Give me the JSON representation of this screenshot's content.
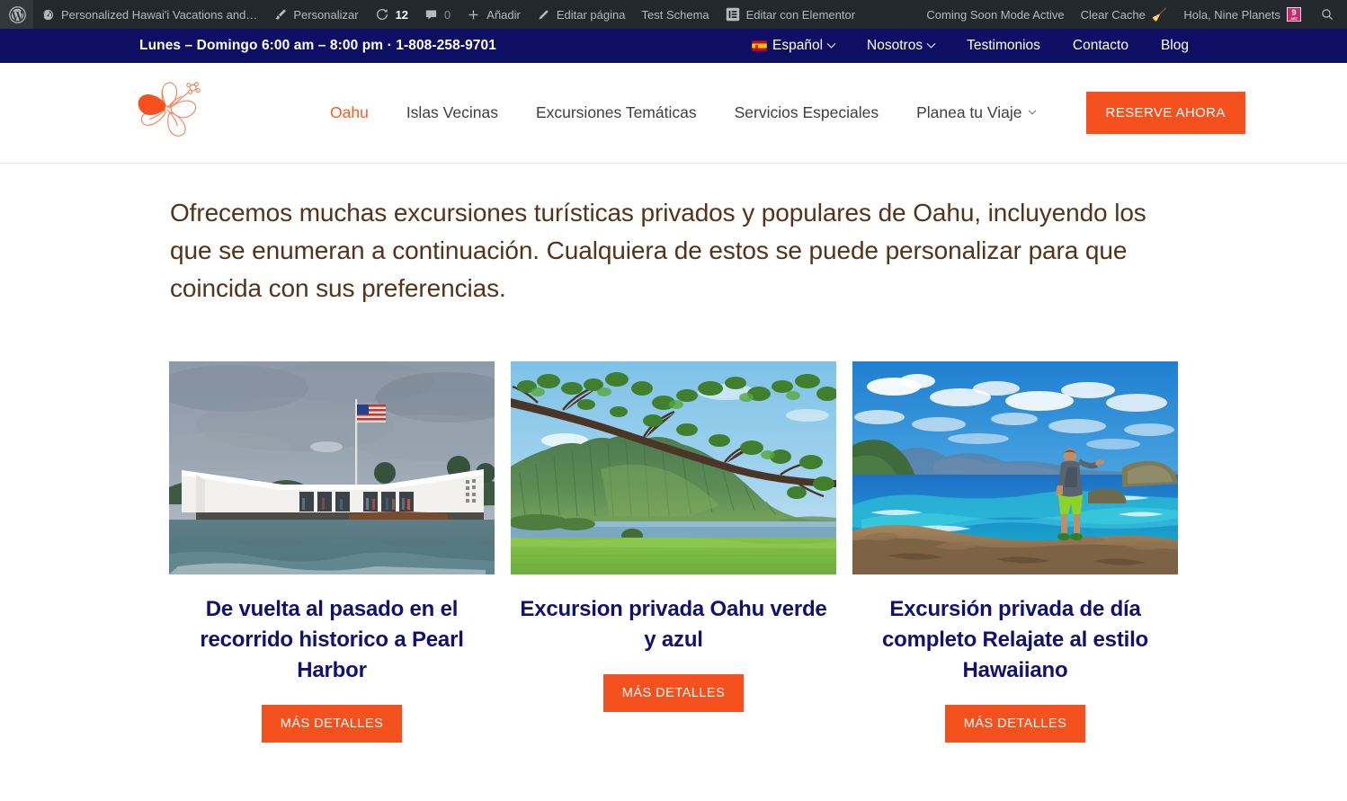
{
  "admin_bar": {
    "logo_icon": "wordpress-icon",
    "items": [
      {
        "label": "Personalized Hawai'i Vacations and…",
        "icon": "dashboard-icon",
        "name": "site-name"
      },
      {
        "label": "Personalizar",
        "icon": "paintbrush-icon",
        "name": "customize"
      },
      {
        "label": "12",
        "icon": "updates-icon",
        "name": "updates"
      },
      {
        "label": "0",
        "icon": "comment-icon",
        "name": "comments"
      },
      {
        "label": "Añadir",
        "icon": "plus-icon",
        "name": "new-content"
      },
      {
        "label": "Editar página",
        "icon": "pencil-icon",
        "name": "edit-page"
      },
      {
        "label": "Test Schema",
        "icon": "",
        "name": "test-schema"
      },
      {
        "label": "Editar con Elementor",
        "icon": "elementor-icon",
        "name": "edit-with-elementor"
      }
    ],
    "right_items": [
      {
        "label": "Coming Soon Mode Active",
        "icon": "",
        "name": "coming-soon-mode"
      },
      {
        "label": "Clear Cache",
        "icon": "broom-icon",
        "name": "clear-cache"
      },
      {
        "label": "Hola, Nine Planets",
        "icon": "avatar",
        "name": "my-account"
      }
    ],
    "search_icon": "search-icon",
    "avatar_text": "9"
  },
  "top_bar": {
    "contact": "Lunes – Domingo 6:00 am – 8:00 pm · 1-808-258-9701",
    "menu": [
      {
        "label": "Español",
        "icon": "spanish-flag-icon",
        "caret": true,
        "name": "language-selector"
      },
      {
        "label": "Nosotros",
        "icon": "",
        "caret": true,
        "name": "top-nav-nosotros"
      },
      {
        "label": "Testimonios",
        "icon": "",
        "caret": false,
        "name": "top-nav-testimonios"
      },
      {
        "label": "Contacto",
        "icon": "",
        "caret": false,
        "name": "top-nav-contacto"
      },
      {
        "label": "Blog",
        "icon": "",
        "caret": false,
        "name": "top-nav-blog"
      }
    ]
  },
  "header": {
    "logo_icon": "hibiscus-flower-logo",
    "nav": [
      {
        "label": "Oahu",
        "caret": false,
        "active": true,
        "name": "nav-oahu"
      },
      {
        "label": "Islas Vecinas",
        "caret": false,
        "active": false,
        "name": "nav-islas-vecinas"
      },
      {
        "label": "Excursiones Temáticas",
        "caret": false,
        "active": false,
        "name": "nav-excursiones-tematicas"
      },
      {
        "label": "Servicios Especiales",
        "caret": false,
        "active": false,
        "name": "nav-servicios-especiales"
      },
      {
        "label": "Planea tu Viaje",
        "caret": true,
        "active": false,
        "name": "nav-planea-tu-viaje"
      }
    ],
    "cta_label": "RESERVE AHORA"
  },
  "main": {
    "intro": "Ofrecemos muchas excursiones turísticas privados y populares de Oahu, incluyendo los que se enumeran a continuación. Cualquiera de estos se puede personalizar para que coincida con sus preferencias.",
    "cards": [
      {
        "title": "De vuelta al pasado en el recorrido historico a Pearl Harbor",
        "button": "MÁS DETALLES",
        "image_alt": "uss-arizona-memorial-pearl-harbor"
      },
      {
        "title": "Excursion privada Oahu verde y azul",
        "button": "MÁS DETALLES",
        "image_alt": "koolau-mountains-kaneohe-bay"
      },
      {
        "title": "Excursión privada de día completo Relajate al estilo Hawaiiano",
        "button": "MÁS DETALLES",
        "image_alt": "makapuu-lookout-coastline-hiker"
      }
    ]
  },
  "colors": {
    "accent_orange": "#f4511e",
    "navy": "#0e0e64",
    "admin_bar": "#23282d",
    "title_navy": "#12126e",
    "intro_brown": "#54331a"
  }
}
